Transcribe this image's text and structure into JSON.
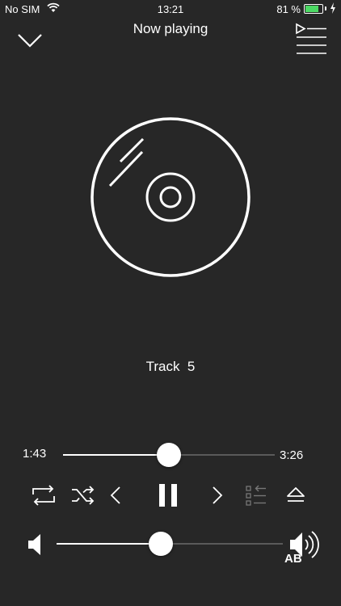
{
  "status_bar": {
    "carrier": "No SIM",
    "time": "13:21",
    "battery_percent": "81 %",
    "battery_level": 0.81,
    "battery_color": "#4cd964"
  },
  "header": {
    "title": "Now playing",
    "collapse_icon": "chevron-down-icon",
    "queue_icon": "queue-list-icon"
  },
  "artwork": {
    "icon": "disc-icon"
  },
  "track": {
    "title": "Track  5"
  },
  "progress": {
    "elapsed": "1:43",
    "total": "3:26",
    "fraction": 0.5
  },
  "controls": {
    "repeat": "repeat-icon",
    "shuffle": "shuffle-icon",
    "previous": "chevron-left-icon",
    "pause": "pause-icon",
    "next": "chevron-right-icon",
    "playlist": "playlist-icon",
    "eject": "eject-icon"
  },
  "volume": {
    "fraction": 0.46,
    "label": "AB"
  },
  "colors": {
    "background": "#272727",
    "foreground": "#ffffff",
    "track_inactive": "#5a5a5a"
  }
}
